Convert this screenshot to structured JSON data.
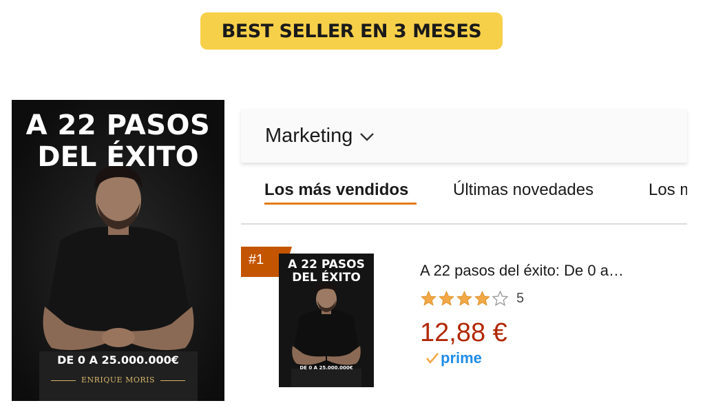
{
  "banner": {
    "text": "BEST SELLER EN 3 MESES"
  },
  "book_cover": {
    "title_line1": "A 22 PASOS",
    "title_line2": "DEL ÉXITO",
    "subtitle": "DE 0 A 25.000.000€",
    "author": "ENRIQUE MORIS"
  },
  "category": {
    "label": "Marketing",
    "icon": "chevron-down-icon"
  },
  "tabs": [
    {
      "label": "Los más vendidos",
      "active": true
    },
    {
      "label": "Últimas novedades",
      "active": false
    },
    {
      "label": "Los m",
      "active": false
    }
  ],
  "product": {
    "rank": "#1",
    "thumb_title_line1": "A 22 PASOS",
    "thumb_title_line2": "DEL ÉXITO",
    "thumb_subtitle": "DE 0 A 25.000.000€",
    "title": "A 22 pasos del éxito: De 0 a…",
    "rating": 4,
    "rating_max": 5,
    "review_count": "5",
    "price": "12,88 €",
    "prime_label": "prime"
  },
  "colors": {
    "banner_bg": "#f7d04a",
    "rank_bg": "#c45500",
    "tab_underline": "#e47911",
    "price": "#b12704",
    "star": "#f3a847",
    "prime": "#1f8ce6"
  }
}
